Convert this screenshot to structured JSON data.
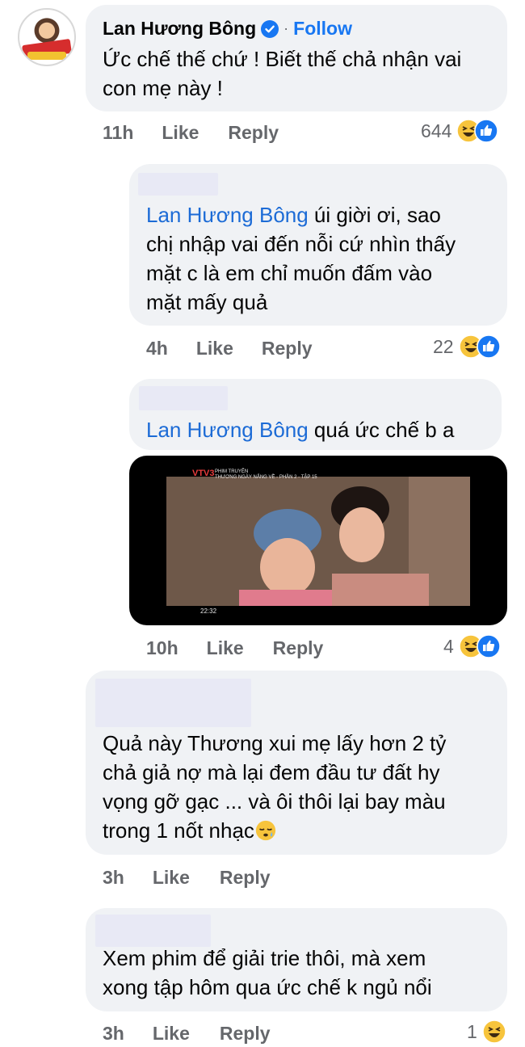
{
  "comments": [
    {
      "author": "Lan Hương Bông",
      "follow_label": "Follow",
      "separator": "·",
      "text_lines": [
        "Ức chế thế chứ ! Biết thế chả nhận vai",
        "con mẹ này !"
      ],
      "time": "11h",
      "like_label": "Like",
      "reply_label": "Reply",
      "reaction_count": "644",
      "reactions": [
        "haha-icon",
        "like-icon"
      ]
    },
    {
      "mention": "Lan Hương Bông",
      "text_lines": [
        " úi giời ơi, sao",
        "chị nhập vai đến nỗi cứ nhìn thấy",
        "mặt c là em chỉ muốn đấm vào",
        "mặt mấy quả"
      ],
      "time": "4h",
      "like_label": "Like",
      "reply_label": "Reply",
      "reaction_count": "22",
      "reactions": [
        "haha-icon",
        "like-icon"
      ]
    },
    {
      "mention": "Lan Hương Bông",
      "text": " quá ức chế b a",
      "video": {
        "logo": "VTV3",
        "title_line1": "PHIM TRUYỆN",
        "title_line2": "THƯƠNG NGÀY NẮNG VỀ - PHẦN 2 - TẬP 15",
        "timestamp": "22:32"
      },
      "time": "10h",
      "like_label": "Like",
      "reply_label": "Reply",
      "reaction_count": "4",
      "reactions": [
        "haha-icon",
        "like-icon"
      ]
    },
    {
      "text_lines": [
        "Quả này Thương xui mẹ lấy hơn 2 tỷ",
        "chả giả nợ mà lại đem đầu tư đất hy",
        "vọng gỡ gạc ... và ôi thôi lại bay màu",
        "trong 1 nốt nhạc"
      ],
      "emoji": "sleepy-face",
      "time": "3h",
      "like_label": "Like",
      "reply_label": "Reply"
    },
    {
      "text_lines": [
        "Xem phim để giải trie thôi, mà xem",
        "xong tập hôm qua ức chế k ngủ nổi"
      ],
      "time": "3h",
      "like_label": "Like",
      "reply_label": "Reply",
      "reaction_count": "1",
      "reactions": [
        "haha-icon"
      ]
    }
  ],
  "colors": {
    "bubble": "#f0f2f5",
    "accent_blue": "#1877f2",
    "mention_blue": "#1c6bd6",
    "meta_gray": "#65676b",
    "redaction": "#e8e9f5"
  }
}
